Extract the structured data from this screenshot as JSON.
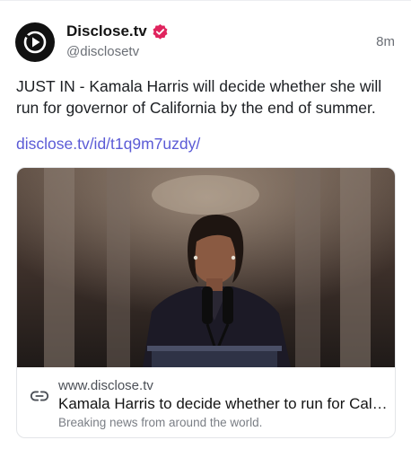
{
  "author": {
    "name": "Disclose.tv",
    "handle": "@disclosetv",
    "verified": true
  },
  "post": {
    "timestamp": "8m",
    "text": "JUST IN - Kamala Harris will decide whether she will run for governor of California by the end of summer.",
    "link": "disclose.tv/id/t1q9m7uzdy/"
  },
  "link_card": {
    "domain": "www.disclose.tv",
    "title": "Kamala Harris to decide whether to run for California governor by end of summer",
    "description": "Breaking news from around the world.",
    "image_icon": "photo-woman-at-podium"
  },
  "colors": {
    "link": "#5b5bd6",
    "verified_badge": "#e0245e",
    "avatar_bg": "#111111"
  }
}
